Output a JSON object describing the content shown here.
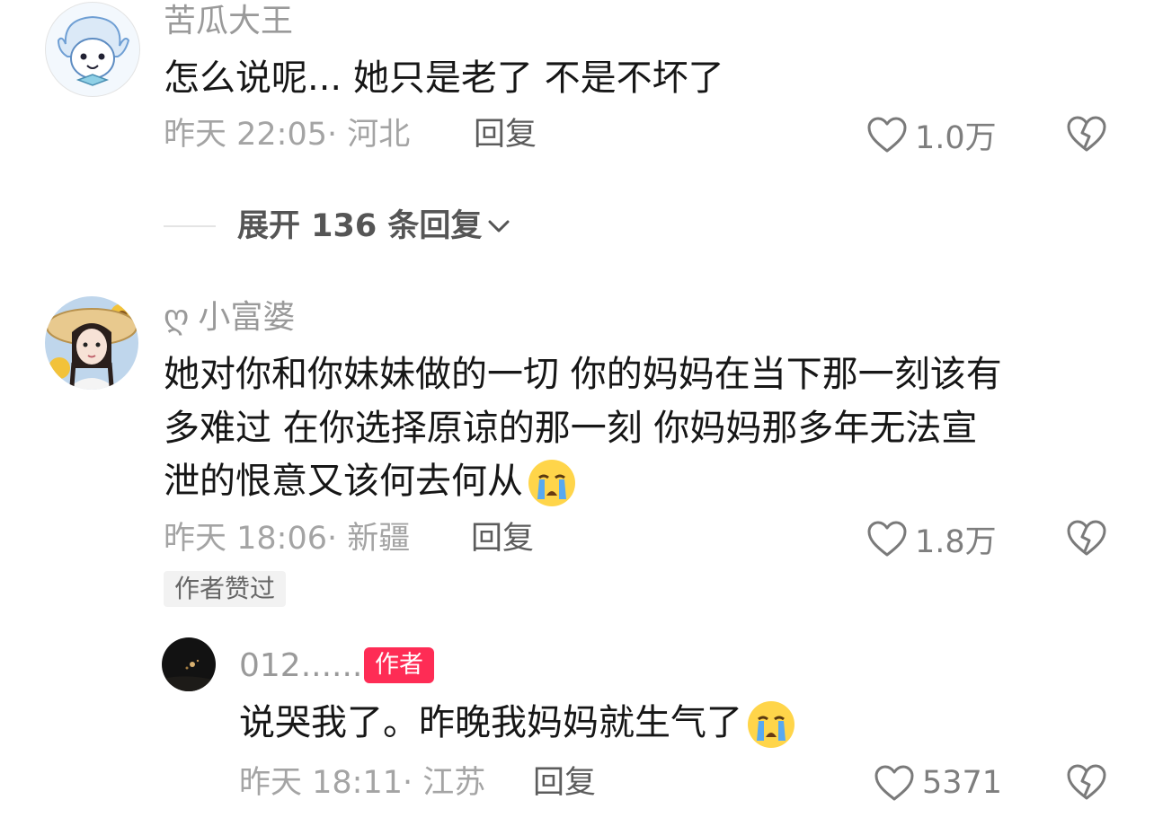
{
  "comments": [
    {
      "username": "苦瓜大王",
      "text": "怎么说呢... 她只是老了  不是不坏了",
      "time": "昨天 22:05",
      "location": "· 河北",
      "reply_label": "回复",
      "likes": "1.0万"
    },
    {
      "username": "小富婆",
      "username_prefix": "ღ",
      "lines": [
        "她对你和你妹妹做的一切 你的妈妈在当下那一刻该有",
        "多难过 在你选择原谅的那一刻 你妈妈那多年无法宣",
        "泄的恨意又该何去何从"
      ],
      "time": "昨天 18:06",
      "location": "· 新疆",
      "reply_label": "回复",
      "likes": "1.8万",
      "badge": "作者赞过"
    }
  ],
  "expand": {
    "label": "展开 136 条回复"
  },
  "reply": {
    "username": "012......",
    "author_badge": "作者",
    "text": "说哭我了。昨晚我妈妈就生气了",
    "time": "昨天 18:11",
    "location": "· 江苏",
    "reply_label": "回复",
    "likes": "5371"
  },
  "colors": {
    "accent": "#fe2c55",
    "meta": "#a4a4a4",
    "text": "#161616"
  },
  "icons": [
    "heart-outline-icon",
    "broken-heart-icon",
    "crying-emoji-icon",
    "chevron-down-icon"
  ]
}
